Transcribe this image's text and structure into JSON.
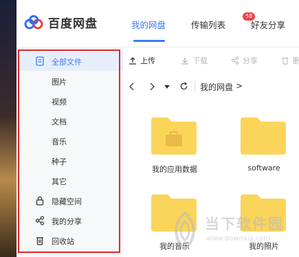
{
  "app": {
    "brand": "百度网盘"
  },
  "nav": {
    "tabs": [
      "我的网盘",
      "传输列表",
      "好友分享"
    ],
    "transfer_badge": "58"
  },
  "toolbar": {
    "upload": "上传",
    "download": "下载",
    "share": "分享",
    "more": "删"
  },
  "path": {
    "current": "我的网盘",
    "sep": ">"
  },
  "sidebar": {
    "items": [
      "全部文件",
      "图片",
      "视频",
      "文档",
      "音乐",
      "种子",
      "其它",
      "隐藏空间",
      "我的分享",
      "回收站"
    ]
  },
  "files": [
    {
      "name": "我的应用数据",
      "icon": "folder-with-case-icon"
    },
    {
      "name": "software",
      "icon": "folder-icon"
    },
    {
      "name": "我的音乐",
      "icon": "folder-icon"
    },
    {
      "name": "我的照片",
      "icon": "folder-icon"
    }
  ],
  "watermark": {
    "title": "当下软件园",
    "url": "www.downxia.com"
  },
  "colors": {
    "accent": "#3a7cfa",
    "highlight_box": "#e0262b",
    "folder": "#fbd55a",
    "badge": "#f0404a"
  }
}
